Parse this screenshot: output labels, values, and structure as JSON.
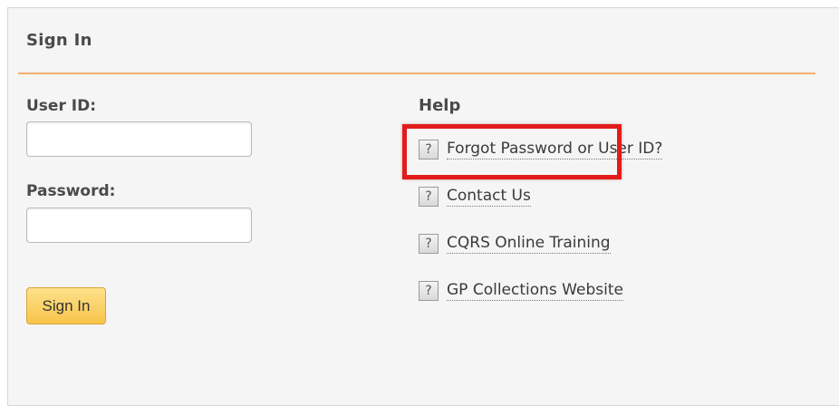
{
  "panel": {
    "title": "Sign In"
  },
  "form": {
    "user_id_label": "User ID:",
    "user_id_value": "",
    "password_label": "Password:",
    "password_value": "",
    "sign_in_label": "Sign In"
  },
  "help": {
    "heading": "Help",
    "items": [
      {
        "icon": "question-icon",
        "label": "Forgot Password or User ID?"
      },
      {
        "icon": "question-icon",
        "label": "Contact Us"
      },
      {
        "icon": "question-icon",
        "label": "CQRS Online Training"
      },
      {
        "icon": "question-icon",
        "label": "GP Collections Website"
      }
    ]
  },
  "icon_glyph": "?",
  "colors": {
    "divider": "#f0b070",
    "button": "#f8c44b",
    "highlight": "#e21b1b"
  }
}
